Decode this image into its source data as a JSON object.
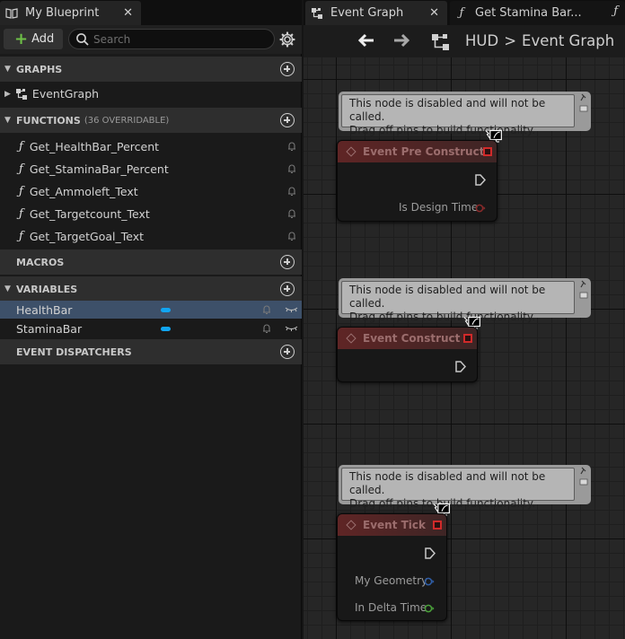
{
  "left_panel": {
    "tab_title": "My Blueprint",
    "close_glyph": "✕",
    "add_label": "Add",
    "search_placeholder": "Search",
    "sections": {
      "graphs": "GRAPHS",
      "functions": "FUNCTIONS",
      "functions_sub": "(36 OVERRIDABLE)",
      "macros": "MACROS",
      "variables": "VARIABLES",
      "dispatchers": "EVENT DISPATCHERS"
    },
    "graph_items": [
      "EventGraph"
    ],
    "functions": [
      "Get_HealthBar_Percent",
      "Get_StaminaBar_Percent",
      "Get_Ammoleft_Text",
      "Get_Targetcount_Text",
      "Get_TargetGoal_Text"
    ],
    "variables": [
      {
        "name": "HealthBar",
        "selected": true,
        "type_color": "#11a5f2"
      },
      {
        "name": "StaminaBar",
        "selected": false,
        "type_color": "#11a5f2"
      }
    ]
  },
  "editor": {
    "tabs": [
      {
        "label": "Event Graph",
        "active": true
      },
      {
        "label": "Get Stamina Bar...",
        "active": false
      }
    ],
    "close_glyph": "✕",
    "breadcrumb": {
      "parent": "HUD",
      "separator": ">",
      "current": "Event Graph"
    },
    "comment_text": [
      "This node is disabled and will not be called.",
      "Drag off pins to build functionality."
    ],
    "nodes": [
      {
        "title": "Event Pre Construct",
        "pins": [
          {
            "label": "Is Design Time",
            "color": "#8a2a2a"
          }
        ]
      },
      {
        "title": "Event Construct",
        "pins": []
      },
      {
        "title": "Event Tick",
        "pins": [
          {
            "label": "My Geometry",
            "color": "#2f5ea8"
          },
          {
            "label": "In Delta Time",
            "color": "#4aa13a"
          }
        ]
      }
    ]
  },
  "colors": {
    "accent_selected": "#3d5069",
    "add_plus": "#6ec047",
    "event_header": "#5f2525"
  }
}
